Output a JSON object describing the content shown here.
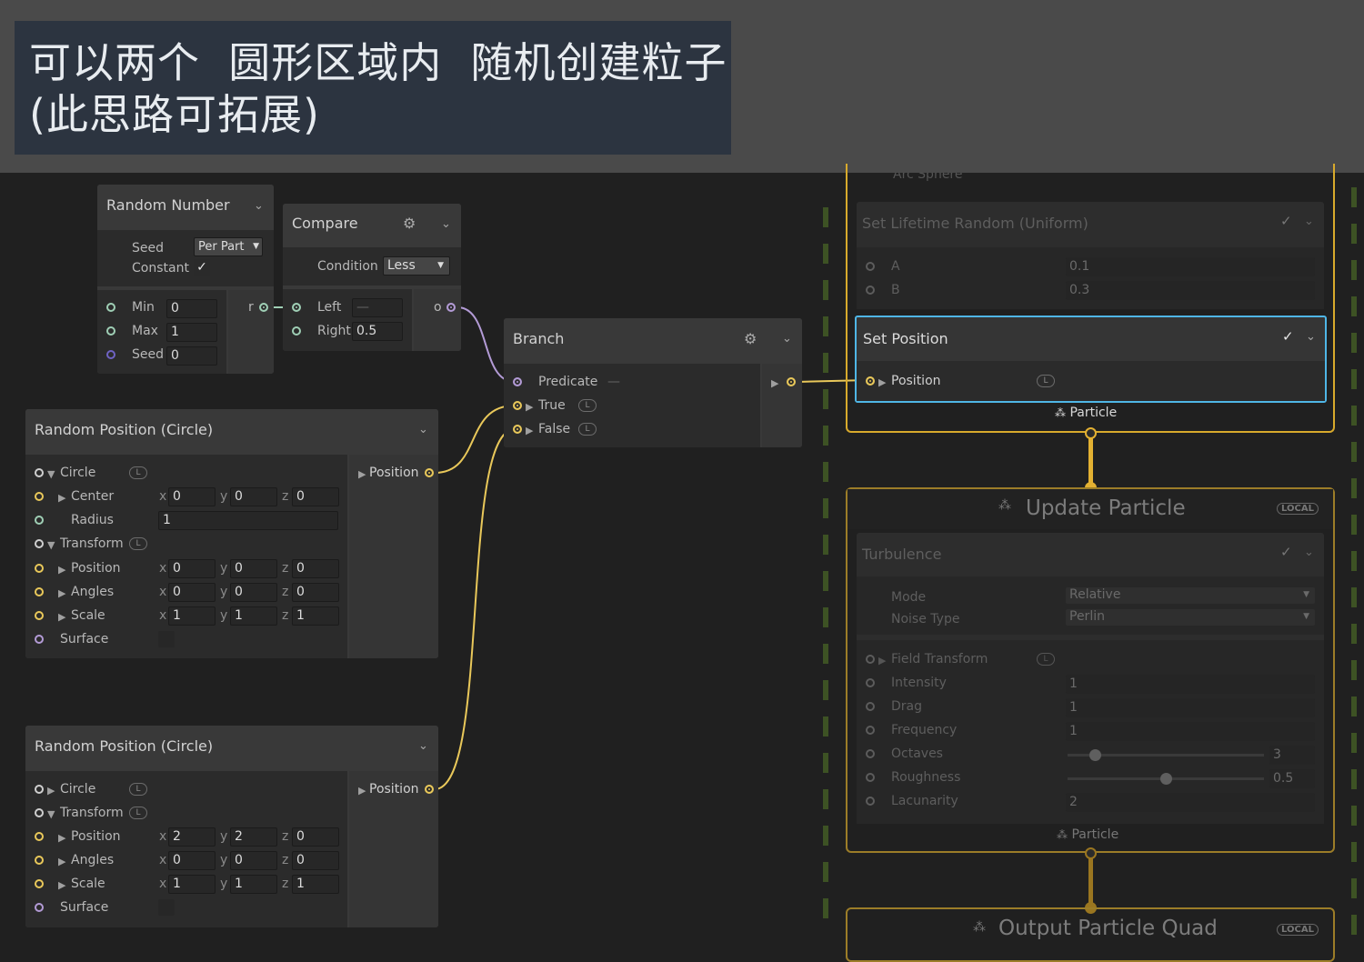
{
  "caption": "可以两个  圆形区域内  随机创建粒子\n(此思路可拓展)",
  "random_number": {
    "title": "Random Number",
    "seed_label": "Seed",
    "seed_mode": "Per Part",
    "constant_label": "Constant",
    "min_label": "Min",
    "min": "0",
    "max_label": "Max",
    "max": "1",
    "seed_in_label": "Seed",
    "seed_in": "0",
    "out_label": "r"
  },
  "compare": {
    "title": "Compare",
    "condition_label": "Condition",
    "condition": "Less",
    "left_label": "Left",
    "left_value": "—",
    "right_label": "Right",
    "right_value": "0.5",
    "out_label": "o"
  },
  "branch": {
    "title": "Branch",
    "predicate_label": "Predicate",
    "predicate_value": "—",
    "true_label": "True",
    "false_label": "False"
  },
  "circle1": {
    "title": "Random Position (Circle)",
    "circle_label": "Circle",
    "center_label": "Center",
    "center": [
      "0",
      "0",
      "0"
    ],
    "radius_label": "Radius",
    "radius": "1",
    "transform_label": "Transform",
    "position_label": "Position",
    "position": [
      "0",
      "0",
      "0"
    ],
    "angles_label": "Angles",
    "angles": [
      "0",
      "0",
      "0"
    ],
    "scale_label": "Scale",
    "scale": [
      "1",
      "1",
      "1"
    ],
    "surface_label": "Surface",
    "out_label": "Position"
  },
  "circle2": {
    "title": "Random Position (Circle)",
    "circle_label": "Circle",
    "transform_label": "Transform",
    "position_label": "Position",
    "position": [
      "2",
      "2",
      "0"
    ],
    "angles_label": "Angles",
    "angles": [
      "0",
      "0",
      "0"
    ],
    "scale_label": "Scale",
    "scale": [
      "1",
      "1",
      "1"
    ],
    "surface_label": "Surface",
    "out_label": "Position"
  },
  "axes": {
    "x": "x",
    "y": "y",
    "z": "z"
  },
  "init_context": {
    "hidden_row": "Arc Sphere",
    "lifetime_title": "Set Lifetime Random (Uniform)",
    "a_label": "A",
    "a_value": "0.1",
    "b_label": "B",
    "b_value": "0.3",
    "set_position_title": "Set Position",
    "position_label": "Position",
    "footer": "Particle"
  },
  "update_context": {
    "title": "Update Particle",
    "badge": "LOCAL",
    "turbulence_title": "Turbulence",
    "mode_label": "Mode",
    "mode": "Relative",
    "noise_label": "Noise Type",
    "noise": "Perlin",
    "field_label": "Field Transform",
    "intensity_label": "Intensity",
    "intensity": "1",
    "drag_label": "Drag",
    "drag": "1",
    "frequency_label": "Frequency",
    "frequency": "1",
    "octaves_label": "Octaves",
    "octaves": "3",
    "octaves_fraction": 0.14,
    "roughness_label": "Roughness",
    "roughness": "0.5",
    "roughness_fraction": 0.5,
    "lacunarity_label": "Lacunarity",
    "lacunarity": "2",
    "footer": "Particle"
  },
  "output_context": {
    "title": "Output Particle Quad",
    "badge": "LOCAL"
  },
  "colors": {
    "float_port": "#9fcfb5",
    "vector_port": "#e9c85a",
    "bool_port": "#b39bd6",
    "selected_outline": "#4fb6e6",
    "flow": "#e9c85a"
  }
}
